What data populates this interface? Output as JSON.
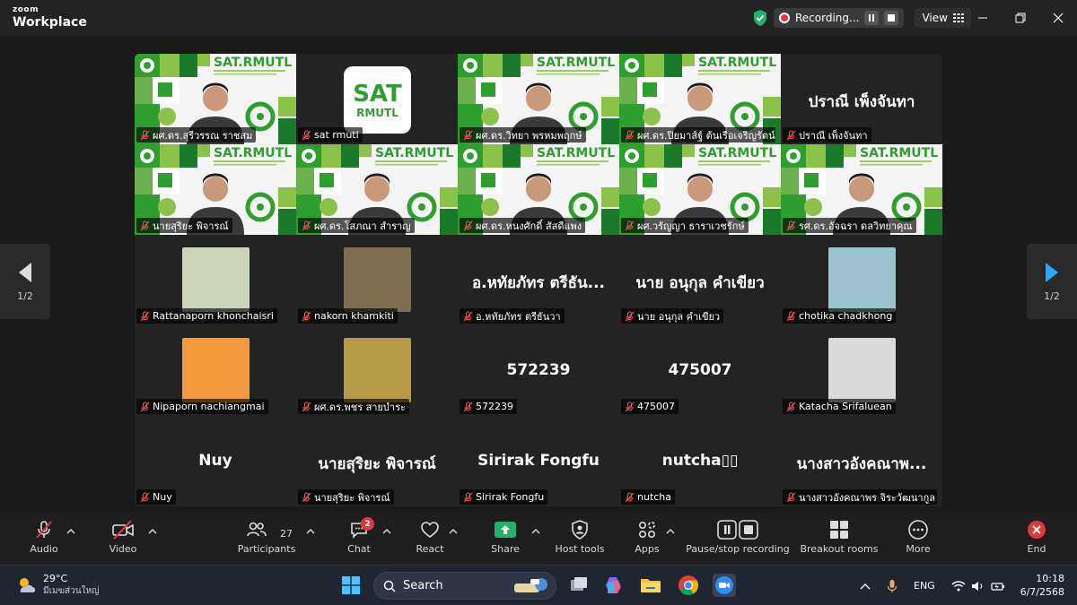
{
  "app": {
    "brand_top": "zoom",
    "brand_bottom": "Workplace"
  },
  "recording": {
    "label": "Recording...",
    "view_label": "View"
  },
  "pager": {
    "left_text": "1/2",
    "right_text": "1/2"
  },
  "tiles": [
    {
      "kind": "brand",
      "name": "ผศ.ดร.สุรีวรรณ ราชสม",
      "active": true
    },
    {
      "kind": "logo",
      "name": "sat rmutl",
      "logo_line1": "SAT",
      "logo_line2": "RMUTL"
    },
    {
      "kind": "brand",
      "name": "ผศ.ดร.วิทยา พรหมพฤกษ์"
    },
    {
      "kind": "brand",
      "name": "ผศ.ดร.ปิยมาส์ฐ์ ต้นเรื่อเจริญรัตน์"
    },
    {
      "kind": "text",
      "name": "ปราณี เพ็งจันทา",
      "big": "ปราณี เพ็งจันทา"
    },
    {
      "kind": "brand",
      "name": "นายสุริยะ พิจารณ์"
    },
    {
      "kind": "brand",
      "name": "ผศ.ดร.โสภณา สำราญ"
    },
    {
      "kind": "brand",
      "name": "ผศ.ดร.หนงศักดิ์ สัสดีแพง"
    },
    {
      "kind": "brand",
      "name": "ผศ.วรัญญา ธาราเวชรักษ์"
    },
    {
      "kind": "brand",
      "name": "รศ.ดร.อัจฉรา ดลวิทยาคุณ"
    },
    {
      "kind": "photo",
      "name": "Rattanaporn khonchaisri",
      "photo": "#c9d4b8"
    },
    {
      "kind": "photo",
      "name": "nakorn khamkiti",
      "photo": "#7d6e52"
    },
    {
      "kind": "text",
      "name": "อ.หทัยภัทร ตรีธันวา",
      "big": "อ.หทัยภัทร ตรีธัน..."
    },
    {
      "kind": "text",
      "name": "นาย อนุกุล คำเขียว",
      "big": "นาย อนุกุล คำเขียว"
    },
    {
      "kind": "photo",
      "name": "chotika chadkhong",
      "photo": "#9dc3cf"
    },
    {
      "kind": "photo",
      "name": "Nipaporn nachiangmai",
      "photo": "#f19a3e"
    },
    {
      "kind": "photo",
      "name": "ผศ.ดร.พชร สายบำระ",
      "photo": "#b89a46"
    },
    {
      "kind": "text",
      "name": "572239",
      "big": "572239"
    },
    {
      "kind": "text",
      "name": "475007",
      "big": "475007"
    },
    {
      "kind": "photo",
      "name": "Katacha Srifaluean",
      "photo": "#d9dbd8"
    },
    {
      "kind": "text",
      "name": "Nuy",
      "big": "Nuy"
    },
    {
      "kind": "text",
      "name": "นายสุริยะ พิจารณ์",
      "big": "นายสุริยะ พิจารณ์"
    },
    {
      "kind": "text",
      "name": "Sirirak Fongfu",
      "big": "Sirirak Fongfu"
    },
    {
      "kind": "text",
      "name": "nutcha",
      "big": "nutcha▯▯"
    },
    {
      "kind": "text",
      "name": "นางสาวอังคณาพร จิระวัฒนากูล",
      "big": "นางสาวอังคณาพ..."
    }
  ],
  "toolbar": {
    "audio": "Audio",
    "video": "Video",
    "participants": "Participants",
    "participants_count": "27",
    "chat": "Chat",
    "chat_badge": "2",
    "react": "React",
    "share": "Share",
    "host_tools": "Host tools",
    "apps": "Apps",
    "pause_stop": "Pause/stop recording",
    "breakout": "Breakout rooms",
    "more": "More",
    "end": "End"
  },
  "taskbar": {
    "temp": "29°C",
    "weather_text": "มีเมฆส่วนใหญ่",
    "search": "Search",
    "lang": "ENG",
    "time": "10:18",
    "date": "6/7/2568"
  },
  "colors": {
    "accent_green": "#23d18b",
    "brand_green": "#2e9e2e",
    "record_red": "#e0383e"
  }
}
